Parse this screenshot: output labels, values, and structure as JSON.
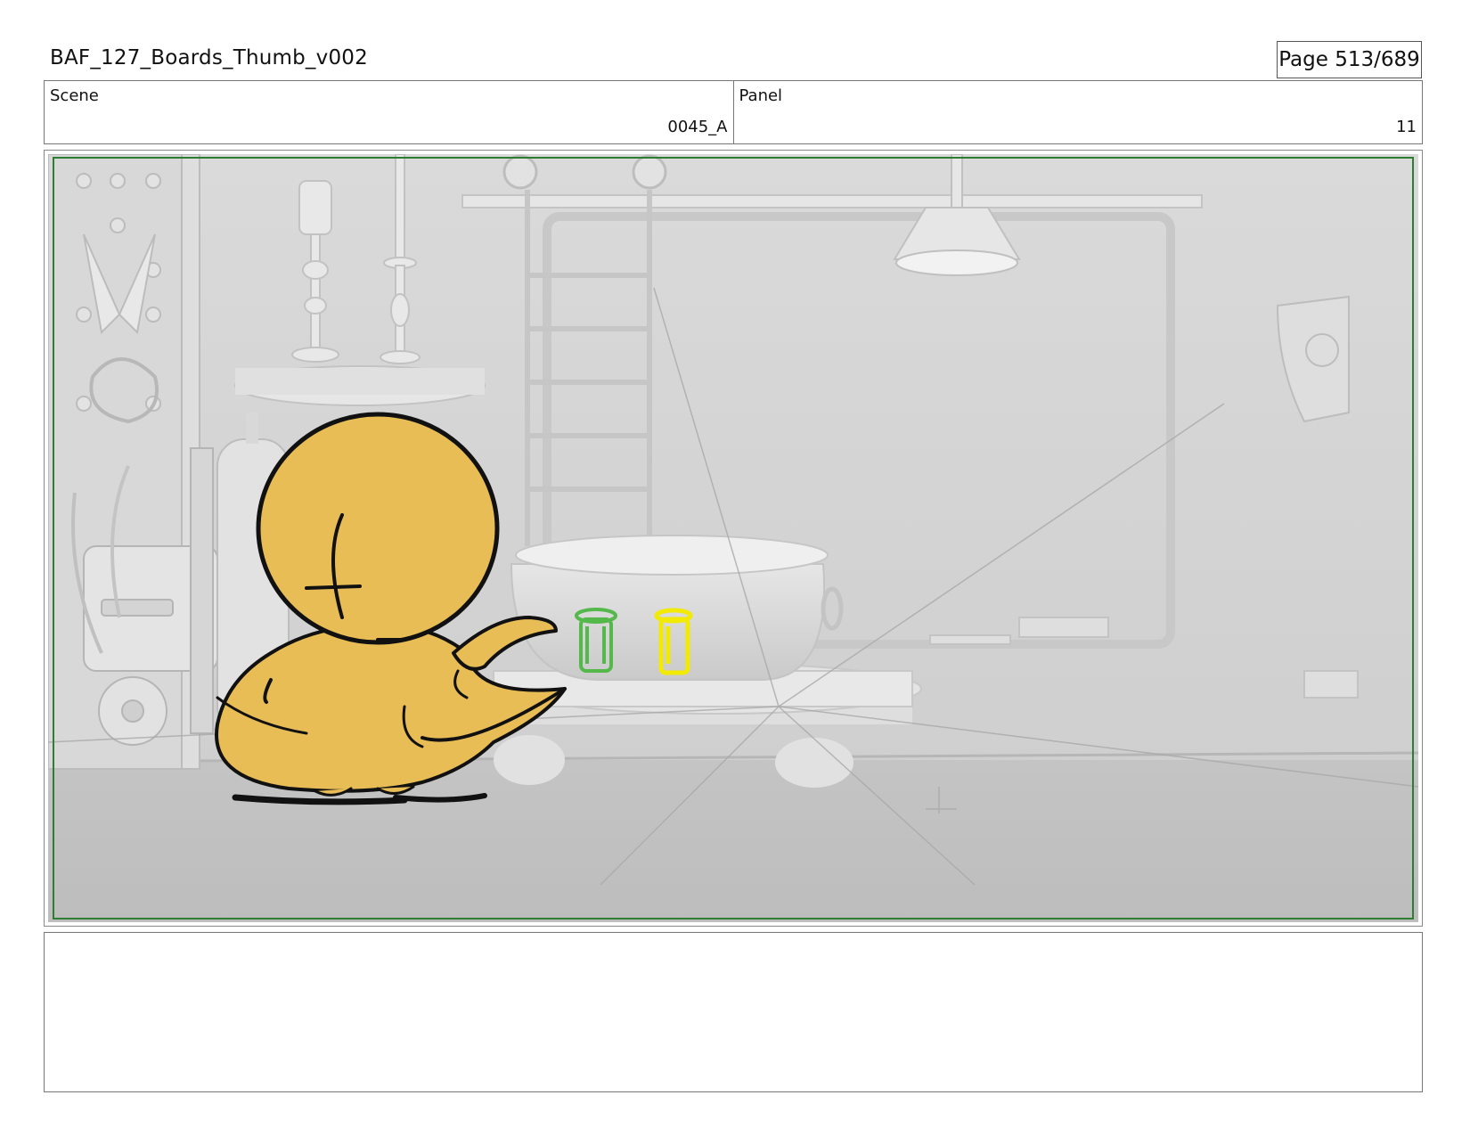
{
  "document": {
    "title": "BAF_127_Boards_Thumb_v002",
    "page": "Page 513/689"
  },
  "info": {
    "scene_label": "Scene",
    "scene_value": "0045_A",
    "panel_label": "Panel",
    "panel_value": "11"
  },
  "panel_art": {
    "description_icons": [
      "chick-character",
      "green-jar",
      "yellow-jar",
      "cauldron",
      "ladder",
      "hanging-lamp",
      "candlesticks"
    ],
    "colors": {
      "safe_frame": "#2e7d32",
      "chick_fill": "#e8bd55",
      "green_jar": "#55b84a",
      "yellow_jar": "#f2ea00"
    }
  },
  "notes": {
    "text": ""
  }
}
